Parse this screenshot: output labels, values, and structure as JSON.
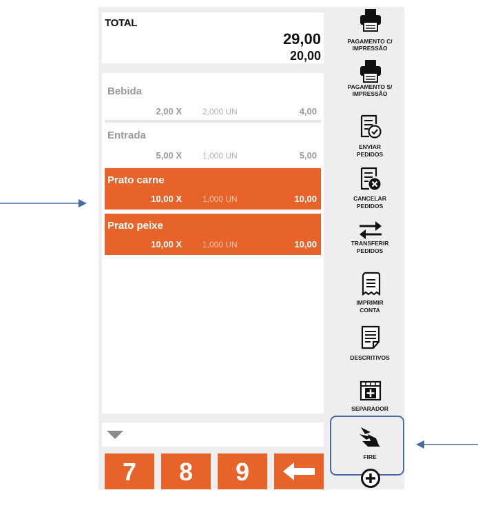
{
  "total": {
    "label": "TOTAL",
    "amount": "29,00",
    "secondary": "20,00"
  },
  "orders": [
    {
      "name": "Bebida",
      "qty": "2,00 X",
      "unit": "2,000 UN",
      "amount": "4,00",
      "selected": false
    },
    {
      "name": "Entrada",
      "qty": "5,00 X",
      "unit": "1,000 UN",
      "amount": "5,00",
      "selected": false
    },
    {
      "name": "Prato carne",
      "qty": "10,00 X",
      "unit": "1,000 UN",
      "amount": "10,00",
      "selected": true
    },
    {
      "name": "Prato peixe",
      "qty": "10,00 X",
      "unit": "1,000 UN",
      "amount": "10,00",
      "selected": true
    }
  ],
  "keypad": {
    "keys": [
      "7",
      "8",
      "9"
    ],
    "backspace_icon": "arrow-left-icon"
  },
  "sidebar": {
    "buttons": [
      {
        "icon": "printer-icon",
        "line1": "PAGAMENTO C/",
        "line2": "IMPRESSÃO"
      },
      {
        "icon": "printer-icon",
        "line1": "PAGAMENTO S/",
        "line2": "IMPRESSÃO"
      },
      {
        "icon": "document-check-icon",
        "line1": "ENVIAR",
        "line2": "PEDIDOS"
      },
      {
        "icon": "document-cancel-icon",
        "line1": "CANCELAR",
        "line2": "PEDIDOS"
      },
      {
        "icon": "swap-arrows-icon",
        "line1": "TRANSFERIR",
        "line2": "PEDIDOS"
      },
      {
        "icon": "receipt-icon",
        "line1": "IMPRIMIR",
        "line2": "CONTA"
      },
      {
        "icon": "document-lines-icon",
        "line1": "DESCRITIVOS",
        "line2": ""
      },
      {
        "icon": "separator-plus-icon",
        "line1": "SEPARADOR",
        "line2": ""
      },
      {
        "icon": "fire-icon",
        "line1": "FIRE",
        "line2": ""
      },
      {
        "icon": "add-circle-icon",
        "line1": "",
        "line2": ""
      }
    ]
  },
  "colors": {
    "accent": "#e8632a",
    "annotation": "#4a6aa0",
    "panel": "#eeeeee"
  }
}
